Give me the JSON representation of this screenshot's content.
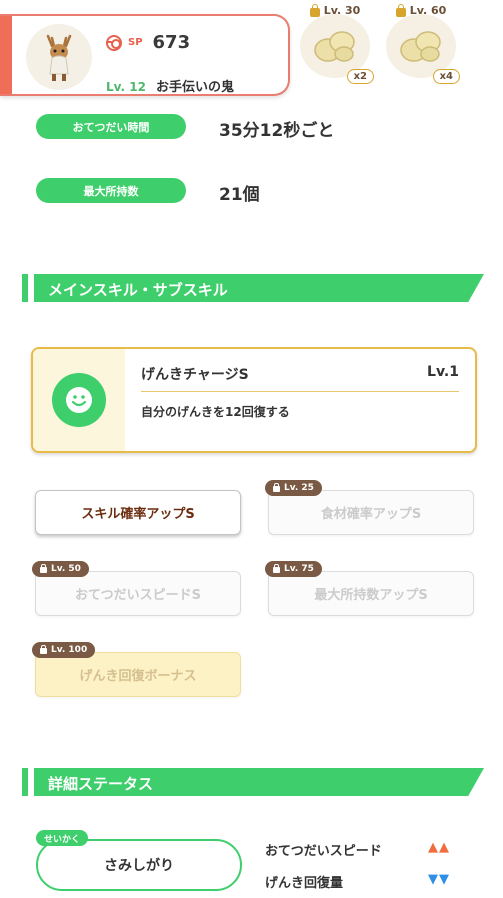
{
  "header": {
    "sp_label": "SP",
    "sp_value": "673",
    "level": "Lv. 12",
    "name": "お手伝いの鬼",
    "avatar_icon": "deer-pokemon-icon",
    "rewards": [
      {
        "level": "Lv. 30",
        "multiplier": "x2",
        "icon": "ginger-ingredient-icon"
      },
      {
        "level": "Lv. 60",
        "multiplier": "x4",
        "icon": "ginger-ingredient-icon"
      }
    ]
  },
  "stats": [
    {
      "label": "おてつだい時間",
      "value": "35分12秒ごと"
    },
    {
      "label": "最大所持数",
      "value": "21個"
    }
  ],
  "skills_section": {
    "title": "メインスキル・サブスキル",
    "main_skill": {
      "name": "げんきチャージS",
      "level": "Lv.1",
      "description": "自分のげんきを12回復する",
      "icon": "smile-icon"
    },
    "sub_skills": [
      {
        "label": "スキル確率アップS",
        "lock": ""
      },
      {
        "label": "食材確率アップS",
        "lock": "Lv. 25"
      },
      {
        "label": "おてつだいスピードS",
        "lock": "Lv. 50"
      },
      {
        "label": "最大所持数アップS",
        "lock": "Lv. 75"
      },
      {
        "label": "げんき回復ボーナス",
        "lock": "Lv. 100"
      }
    ]
  },
  "details_section": {
    "title": "詳細ステータス",
    "nature_tag": "せいかく",
    "nature": "さみしがり",
    "effects": [
      {
        "label": "おてつだいスピード",
        "arrows": "▲▲",
        "color": "#f06c3c"
      },
      {
        "label": "げんき回復量",
        "arrows": "▼▼",
        "color": "#2f8fe6"
      }
    ]
  },
  "colors": {
    "accent_green": "#3ecf6c",
    "accent_red": "#f06e58",
    "gold": "#e7bb49"
  }
}
